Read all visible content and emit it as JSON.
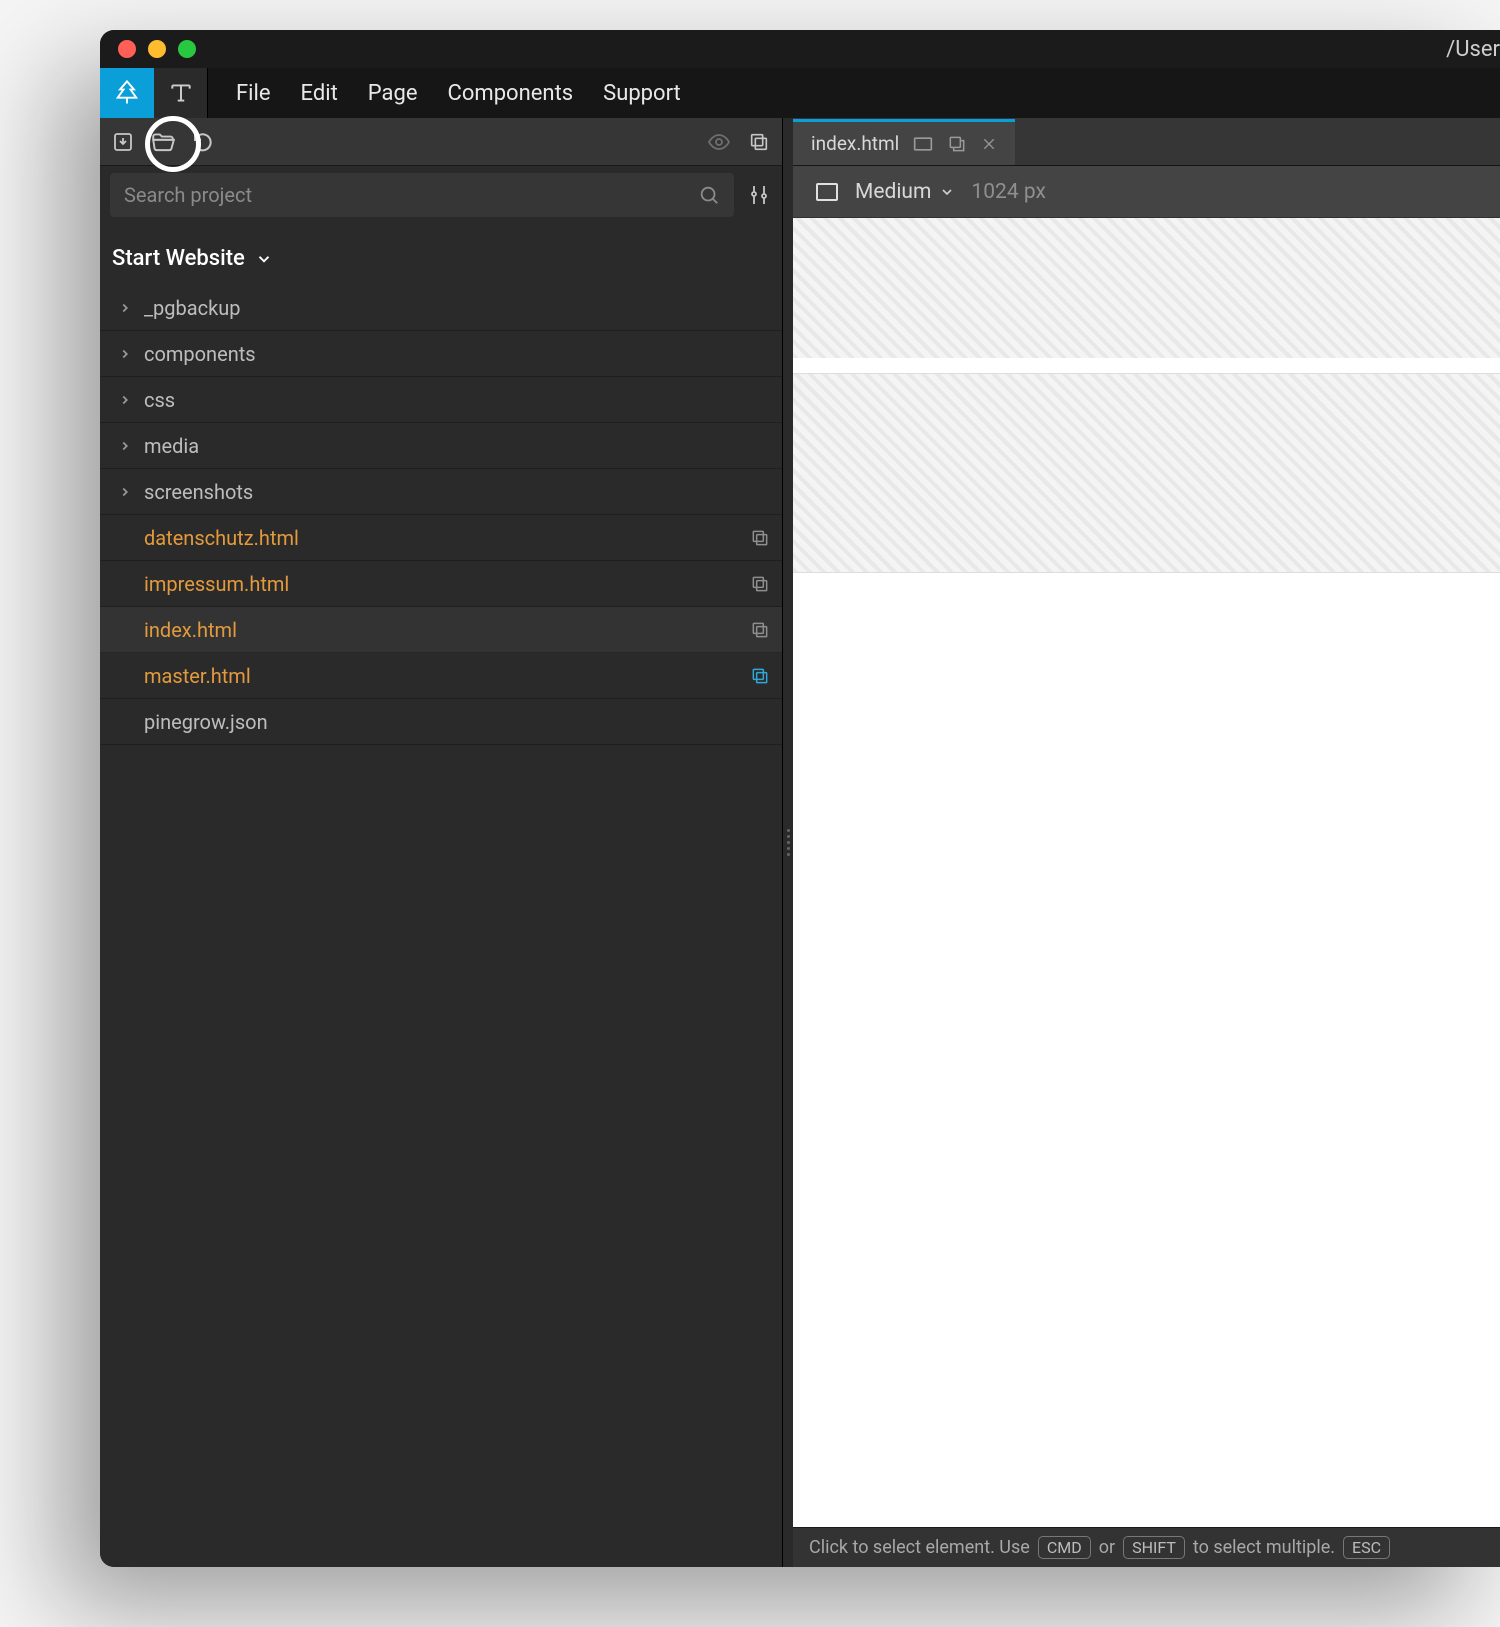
{
  "window": {
    "title": "/User"
  },
  "menubar": {
    "items": [
      "File",
      "Edit",
      "Page",
      "Components",
      "Support"
    ]
  },
  "search": {
    "placeholder": "Search project"
  },
  "project": {
    "name": "Start Website"
  },
  "tree": {
    "folders": [
      {
        "name": "_pgbackup"
      },
      {
        "name": "components"
      },
      {
        "name": "css"
      },
      {
        "name": "media"
      },
      {
        "name": "screenshots"
      }
    ],
    "files": [
      {
        "name": "datenschutz.html",
        "orange": true,
        "icon": "copy",
        "active": false
      },
      {
        "name": "impressum.html",
        "orange": true,
        "icon": "copy",
        "active": false
      },
      {
        "name": "index.html",
        "orange": true,
        "icon": "copy",
        "active": true
      },
      {
        "name": "master.html",
        "orange": true,
        "icon": "copy-blue",
        "active": false
      },
      {
        "name": "pinegrow.json",
        "orange": false,
        "icon": "",
        "active": false
      }
    ]
  },
  "tab": {
    "label": "index.html"
  },
  "viewport": {
    "size_label": "Medium",
    "width_label": "1024 px"
  },
  "statusbar": {
    "prefix": "Click to select element. Use",
    "key1": "CMD",
    "mid": "or",
    "key2": "SHIFT",
    "suffix": "to select multiple.",
    "key3": "ESC"
  }
}
